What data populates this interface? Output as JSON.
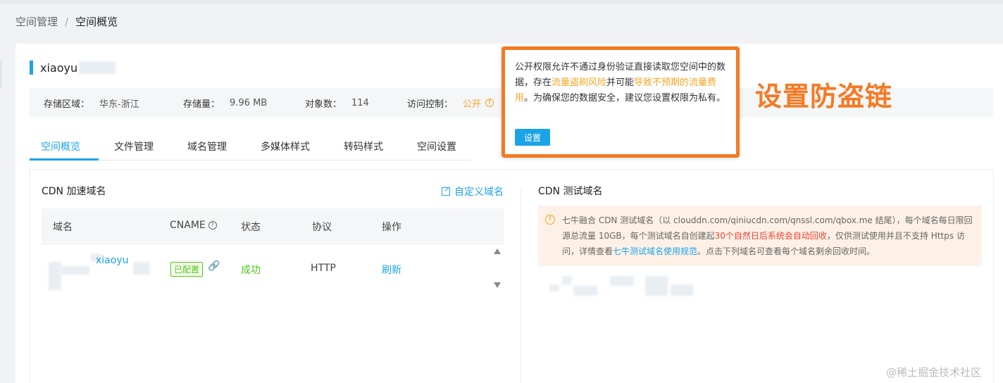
{
  "breadcrumb": {
    "parent": "空间管理",
    "separator": "/",
    "current": "空间概览"
  },
  "bucket": {
    "name": "xiaoyu"
  },
  "stats": [
    {
      "label": "存储区域：",
      "value": "华东-浙江"
    },
    {
      "label": "存储量：",
      "value": "9.96 MB"
    },
    {
      "label": "对象数：",
      "value": "114"
    },
    {
      "label": "访问控制：",
      "value": "公开"
    }
  ],
  "tabs": [
    {
      "label": "空间概览",
      "active": true
    },
    {
      "label": "文件管理"
    },
    {
      "label": "域名管理"
    },
    {
      "label": "多媒体样式"
    },
    {
      "label": "转码样式"
    },
    {
      "label": "空间设置"
    }
  ],
  "cdn": {
    "title": "CDN 加速域名",
    "custom_domain_label": "自定义域名",
    "columns": [
      "域名",
      "CNAME",
      "状态",
      "协议",
      "操作"
    ],
    "row": {
      "domain": "xiaoyu",
      "cname_tag": "已配置",
      "status": "成功",
      "protocol": "HTTP",
      "action": "刷新"
    }
  },
  "test_domain": {
    "title": "CDN 测试域名",
    "alert_part1": "七牛融合 CDN 测试域名（以 clouddn.com/qiniucdn.com/qnssl.com/qbox.me 结尾），每个域名每日限回源总流量 10GB，每个测试域名自创建起",
    "alert_red": "30个自然日后系统会自动回收",
    "alert_part2": "，仅供测试使用并且不支持 Https 访问，详情查看",
    "alert_link": "七牛测试域名使用规范",
    "alert_part3": "。点击下列域名可查看每个域名剩余回收时间。"
  },
  "popup": {
    "text1": "公开权限允许不通过身份验证直接读取您空间中的数据，存在",
    "highlight1": "流量盗刷风险",
    "text2": "并可能",
    "highlight2": "导致不预期的流量费用",
    "text3": "。为确保您的数据安全，建议您设置权限为私有。",
    "button": "设置"
  },
  "annotation": "设置防盗链",
  "watermark": "@稀土掘金技术社区",
  "colors": {
    "accent": "#1ba3e8",
    "warning": "#f5a623",
    "success": "#52c41a",
    "highlight_border": "#f47a23",
    "danger": "#f04134"
  }
}
